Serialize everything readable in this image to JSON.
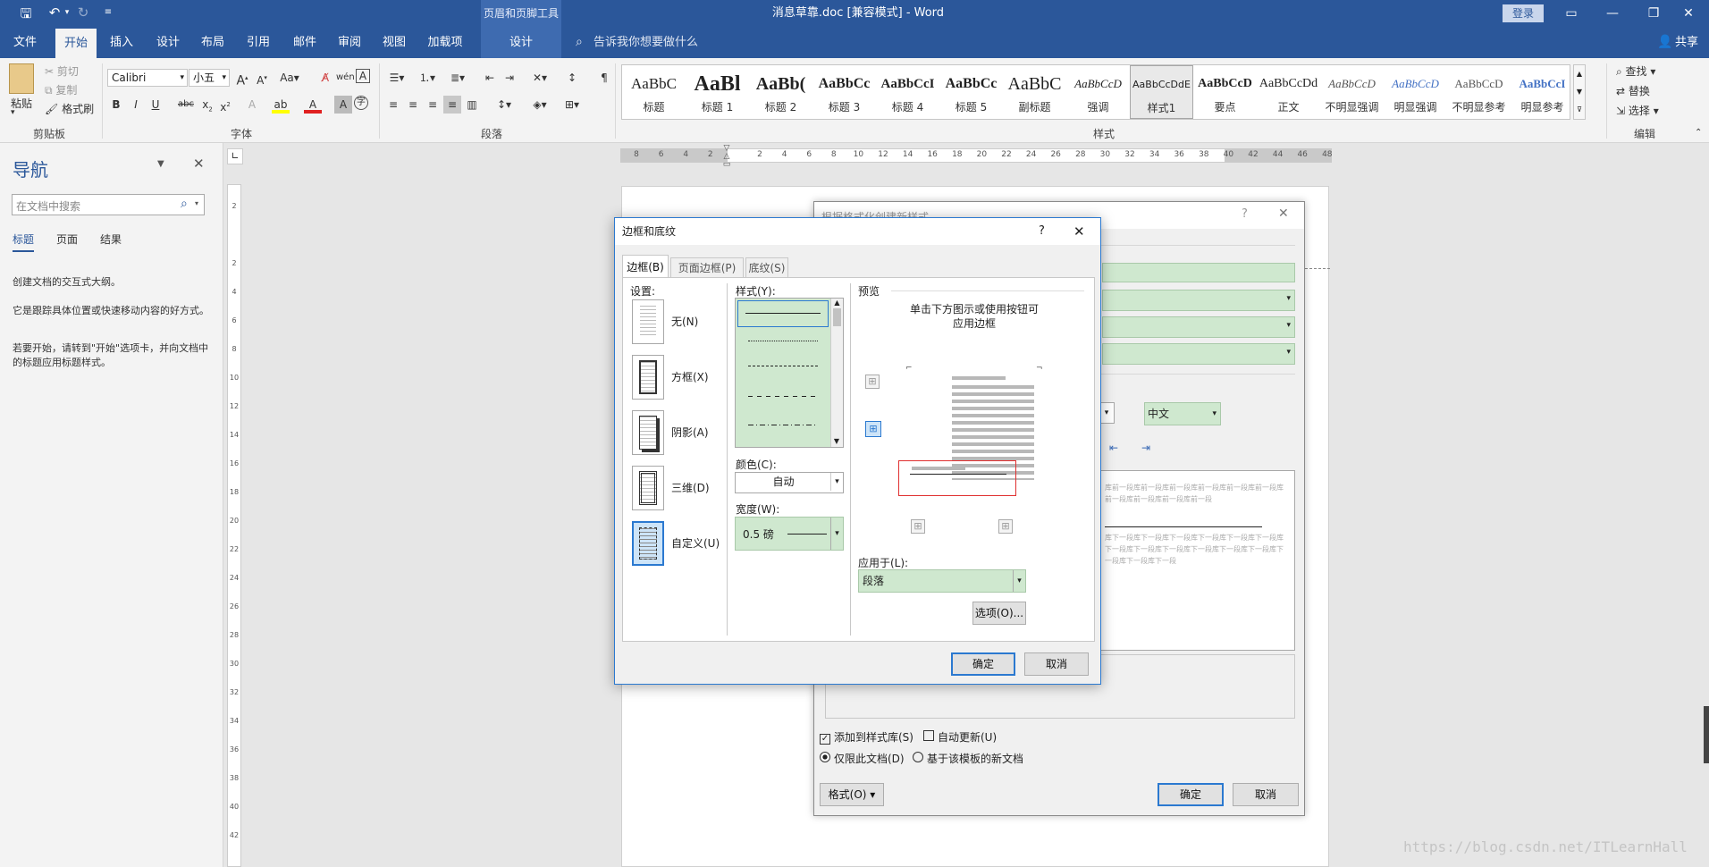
{
  "window": {
    "title": "消息草靠.doc [兼容模式] - Word",
    "context_tools": "页眉和页脚工具",
    "login": "登录"
  },
  "tabs": [
    "文件",
    "开始",
    "插入",
    "设计",
    "布局",
    "引用",
    "邮件",
    "审阅",
    "视图",
    "加载项",
    "设计"
  ],
  "tell_me": "告诉我你想要做什么",
  "share": "共享",
  "ribbon": {
    "clipboard": {
      "paste": "粘贴",
      "cut": "剪切",
      "copy": "复制",
      "format_painter": "格式刷",
      "label": "剪贴板"
    },
    "font": {
      "name": "Calibri",
      "size": "小五",
      "label": "字体"
    },
    "paragraph": {
      "label": "段落"
    },
    "styles": {
      "label": "样式",
      "items": [
        {
          "preview": "AaBbC",
          "name": "标题"
        },
        {
          "preview": "AaBl",
          "name": "标题 1"
        },
        {
          "preview": "AaBb(",
          "name": "标题 2"
        },
        {
          "preview": "AaBbCc",
          "name": "标题 3"
        },
        {
          "preview": "AaBbCcI",
          "name": "标题 4"
        },
        {
          "preview": "AaBbCc",
          "name": "标题 5"
        },
        {
          "preview": "AaBbC",
          "name": "副标题"
        },
        {
          "preview": "AaBbCcD",
          "name": "强调"
        },
        {
          "preview": "AaBbCcDdE",
          "name": "样式1"
        },
        {
          "preview": "AaBbCcD",
          "name": "要点"
        },
        {
          "preview": "AaBbCcDd",
          "name": "正文"
        },
        {
          "preview": "AaBbCcD",
          "name": "不明显强调"
        },
        {
          "preview": "AaBbCcD",
          "name": "明显强调"
        },
        {
          "preview": "AaBbCcD",
          "name": "不明显参考"
        },
        {
          "preview": "AaBbCcI",
          "name": "明显参考"
        }
      ]
    },
    "editing": {
      "find": "查找",
      "replace": "替换",
      "select": "选择",
      "label": "编辑"
    }
  },
  "nav": {
    "title": "导航",
    "search_placeholder": "在文档中搜索",
    "tabs": [
      "标题",
      "页面",
      "结果"
    ],
    "text1": "创建文档的交互式大纲。",
    "text2": "它是跟踪具体位置或快速移动内容的好方式。",
    "text3": "若要开始，请转到\"开始\"选项卡，并向文档中的标题应用标题样式。"
  },
  "hruler_ticks": [
    "8",
    "6",
    "4",
    "2",
    "",
    "2",
    "4",
    "6",
    "8",
    "10",
    "12",
    "14",
    "16",
    "18",
    "20",
    "22",
    "24",
    "26",
    "28",
    "30",
    "32",
    "34",
    "36",
    "38",
    "40",
    "42",
    "44",
    "46",
    "48"
  ],
  "vruler_ticks": [
    "2",
    "",
    "2",
    "4",
    "6",
    "8",
    "10",
    "12",
    "14",
    "16",
    "18",
    "20",
    "22",
    "24",
    "26",
    "28",
    "30",
    "32",
    "34",
    "36",
    "38",
    "40",
    "42"
  ],
  "watermark": "https://blog.csdn.net/ITLearnHall",
  "back_dialog": {
    "title": "根据格式化创建新样式",
    "lang": "中文",
    "preview_prev": "库前一段库前一段库前一段库前一段库前一段库前一段库前一段库前一段库前一段库前一段",
    "preview_next": "库下一段库下一段库下一段库下一段库下一段库下一段库下一段库下一段库下一段库下一段库下一段库下一段库下一段库下一段库下一段",
    "add_to_gallery": "添加到样式库(S)",
    "auto_update": "自动更新(U)",
    "only_this_doc": "仅限此文档(D)",
    "new_docs": "基于该模板的新文档",
    "format": "格式(O)",
    "ok": "确定",
    "cancel": "取消"
  },
  "dialog": {
    "title": "边框和底纹",
    "tabs": [
      "边框(B)",
      "页面边框(P)",
      "底纹(S)"
    ],
    "setting_label": "设置:",
    "settings": [
      "无(N)",
      "方框(X)",
      "阴影(A)",
      "三维(D)",
      "自定义(U)"
    ],
    "style_label": "样式(Y):",
    "color_label": "颜色(C):",
    "color_value": "自动",
    "width_label": "宽度(W):",
    "width_value": "0.5 磅",
    "preview_label": "预览",
    "preview_hint1": "单击下方图示或使用按钮可",
    "preview_hint2": "应用边框",
    "apply_label": "应用于(L):",
    "apply_value": "段落",
    "options": "选项(O)...",
    "ok": "确定",
    "cancel": "取消"
  },
  "colors": {
    "word_blue": "#2b579a",
    "accent": "#2b79d0",
    "green_field": "#cfe8cf",
    "selection_red": "#e03030"
  }
}
